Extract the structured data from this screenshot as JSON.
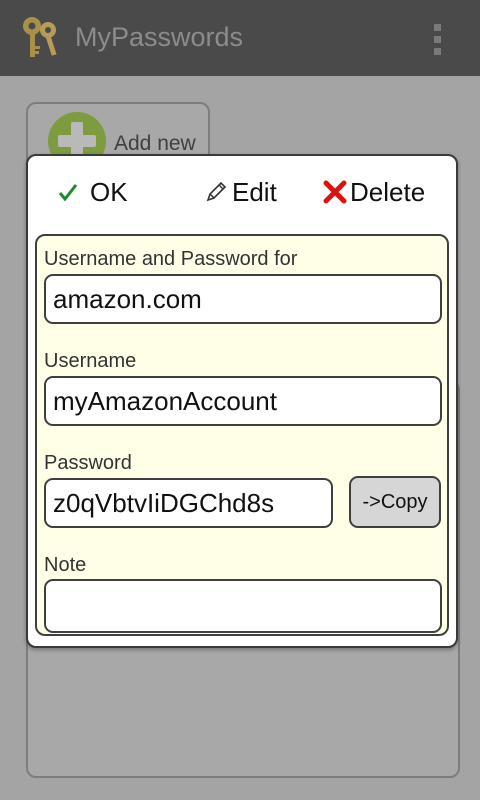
{
  "app": {
    "title": "MyPasswords"
  },
  "list": {
    "add_new_label": "Add new"
  },
  "dialog": {
    "ok_label": "OK",
    "edit_label": "Edit",
    "delete_label": "Delete",
    "fields": {
      "site_label": "Username and Password for",
      "site_value": "amazon.com",
      "username_label": "Username",
      "username_value": "myAmazonAccount",
      "password_label": "Password",
      "password_value": "z0qVbtvIiDGChd8s",
      "copy_label": "->Copy",
      "note_label": "Note",
      "note_value": ""
    }
  },
  "icons": {
    "app": "keys-icon",
    "menu": "overflow-menu-icon",
    "add": "add-circle-icon",
    "ok": "checkmark-icon",
    "edit": "pencil-icon",
    "delete": "red-x-icon"
  },
  "colors": {
    "actionbar": "#4a4a4a",
    "form_background": "#ffffe8",
    "delete_red": "#e01010",
    "ok_green": "#1e8a2e"
  }
}
